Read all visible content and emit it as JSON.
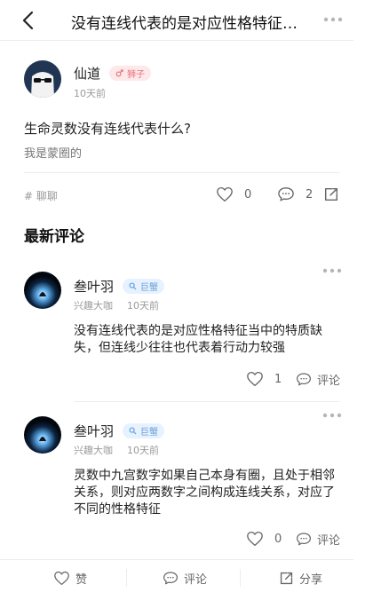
{
  "header": {
    "title": "没有连线代表的是对应性格特征…"
  },
  "post": {
    "author": "仙道",
    "badge": "狮子",
    "time": "10天前",
    "title": "生命灵数没有连线代表什么?",
    "body": "我是蒙圈的",
    "tag": "# 聊聊",
    "like_count": "0",
    "comment_count": "2"
  },
  "comments_section": {
    "heading": "最新评论"
  },
  "comments": [
    {
      "author": "叁叶羽",
      "badge": "巨蟹",
      "role": "兴趣大咖",
      "time": "10天前",
      "text": "没有连线代表的是对应性格特征当中的特质缺失，但连线少往往也代表着行动力较强",
      "like_count": "1",
      "reply_label": "评论"
    },
    {
      "author": "叁叶羽",
      "badge": "巨蟹",
      "role": "兴趣大咖",
      "time": "10天前",
      "text": "灵数中九宫数字如果自己本身有圈，且处于相邻关系，则对应两数字之间构成连线关系，对应了不同的性格特征",
      "like_count": "0",
      "reply_label": "评论"
    }
  ],
  "bottom_bar": {
    "like_label": "赞",
    "comment_label": "评论",
    "share_label": "分享"
  },
  "colors": {
    "badge_red": "#e8727f",
    "badge_blue": "#6a9fd7",
    "divider": "#ececec"
  }
}
